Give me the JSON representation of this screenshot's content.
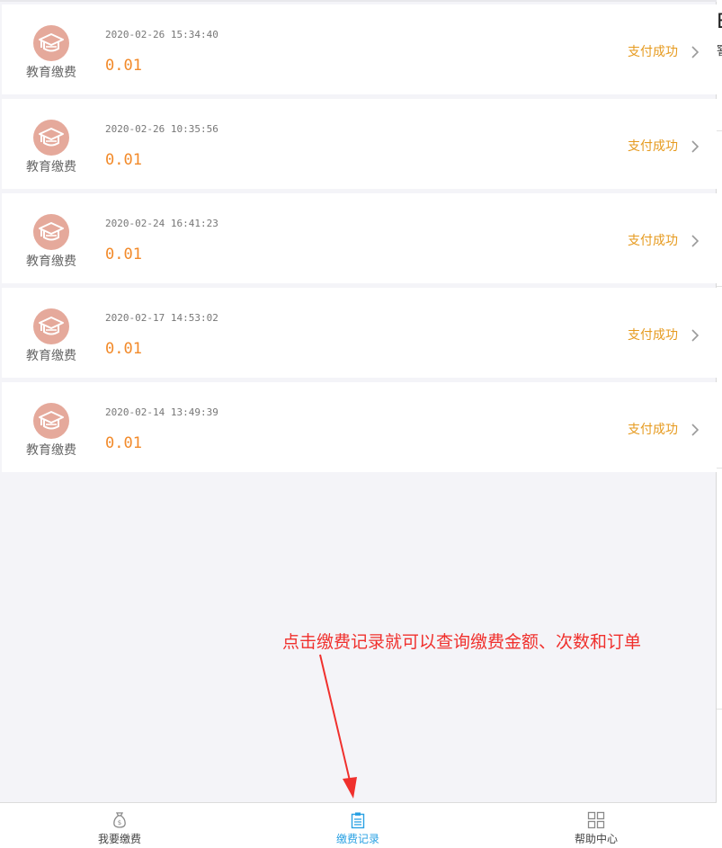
{
  "records": [
    {
      "category": "教育缴费",
      "time": "2020-02-26 15:34:40",
      "amount": "0.01",
      "status": "支付成功"
    },
    {
      "category": "教育缴费",
      "time": "2020-02-26 10:35:56",
      "amount": "0.01",
      "status": "支付成功"
    },
    {
      "category": "教育缴费",
      "time": "2020-02-24 16:41:23",
      "amount": "0.01",
      "status": "支付成功"
    },
    {
      "category": "教育缴费",
      "time": "2020-02-17 14:53:02",
      "amount": "0.01",
      "status": "支付成功"
    },
    {
      "category": "教育缴费",
      "time": "2020-02-14 13:49:39",
      "amount": "0.01",
      "status": "支付成功"
    }
  ],
  "annotation": "点击缴费记录就可以查询缴费金额、次数和订单",
  "tabs": [
    {
      "label": "我要缴费",
      "icon": "money-bag-icon",
      "active": false
    },
    {
      "label": "缴费记录",
      "icon": "clipboard-icon",
      "active": true
    },
    {
      "label": "帮助中心",
      "icon": "grid-icon",
      "active": false
    }
  ],
  "edge": {
    "glyph1": "E",
    "glyph2": "窨"
  },
  "colors": {
    "amount": "#f28a2a",
    "status": "#e69a1e",
    "logo": "#e5a99b",
    "tab_active": "#2aa1e3",
    "annotation": "#f0302d",
    "background": "#f4f4f8"
  }
}
